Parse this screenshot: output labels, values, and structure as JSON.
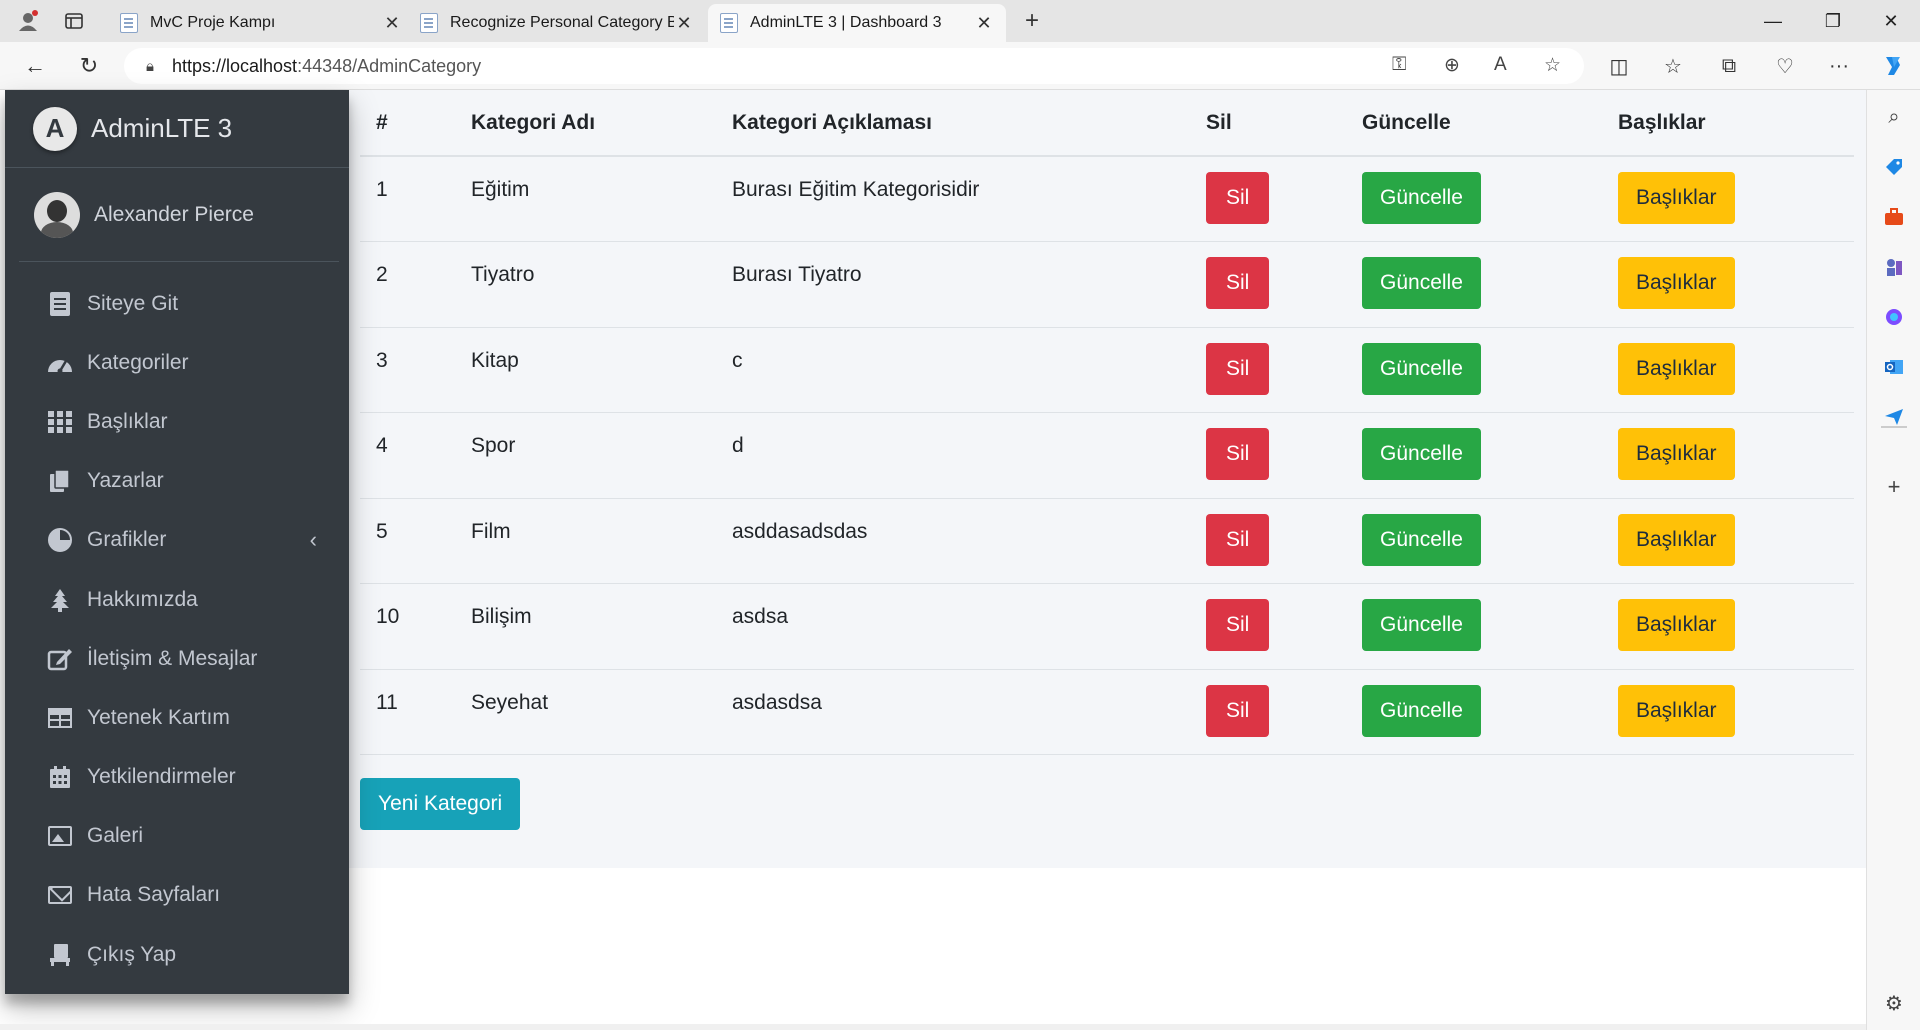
{
  "browser": {
    "tabs": [
      {
        "title": "MvC Proje Kampı"
      },
      {
        "title": "Recognize Personal Category Bo"
      },
      {
        "title": "AdminLTE 3 | Dashboard 3"
      }
    ],
    "url_host": "https://localhost",
    "url_path": ":44348/AdminCategory"
  },
  "sidebar": {
    "brand": "AdminLTE 3",
    "brand_logo": "A",
    "user": "Alexander Pierce",
    "items": [
      {
        "label": "Siteye Git",
        "icon": "book-icon"
      },
      {
        "label": "Kategoriler",
        "icon": "tachometer-icon"
      },
      {
        "label": "Başlıklar",
        "icon": "th-grid-icon"
      },
      {
        "label": "Yazarlar",
        "icon": "copy-icon"
      },
      {
        "label": "Grafikler",
        "icon": "pie-chart-icon"
      },
      {
        "label": "Hakkımızda",
        "icon": "tree-icon"
      },
      {
        "label": "İletişim & Mesajlar",
        "icon": "edit-icon"
      },
      {
        "label": "Yetenek Kartım",
        "icon": "table-icon"
      },
      {
        "label": "Yetkilendirmeler",
        "icon": "calendar-icon"
      },
      {
        "label": "Galeri",
        "icon": "image-icon"
      },
      {
        "label": "Hata Sayfaları",
        "icon": "envelope-icon"
      },
      {
        "label": "Çıkış Yap",
        "icon": "chair-icon"
      }
    ]
  },
  "table": {
    "headers": [
      "#",
      "Kategori Adı",
      "Kategori Açıklaması",
      "Sil",
      "Güncelle",
      "Başlıklar"
    ],
    "rows": [
      {
        "id": "1",
        "name": "Eğitim",
        "desc": "Burası Eğitim Kategorisidir"
      },
      {
        "id": "2",
        "name": "Tiyatro",
        "desc": "Burası Tiyatro"
      },
      {
        "id": "3",
        "name": "Kitap",
        "desc": "c"
      },
      {
        "id": "4",
        "name": "Spor",
        "desc": "d"
      },
      {
        "id": "5",
        "name": "Film",
        "desc": "asddasadsdas"
      },
      {
        "id": "10",
        "name": "Bilişim",
        "desc": "asdsa"
      },
      {
        "id": "11",
        "name": "Seyehat",
        "desc": "asdasdsa"
      }
    ],
    "btn_delete": "Sil",
    "btn_update": "Güncelle",
    "btn_titles": "Başlıklar"
  },
  "new_button": "Yeni Kategori",
  "colors": {
    "danger": "#dc3545",
    "success": "#28a745",
    "warning": "#ffc107",
    "info": "#17a2b8",
    "sidebar": "#343a40"
  }
}
